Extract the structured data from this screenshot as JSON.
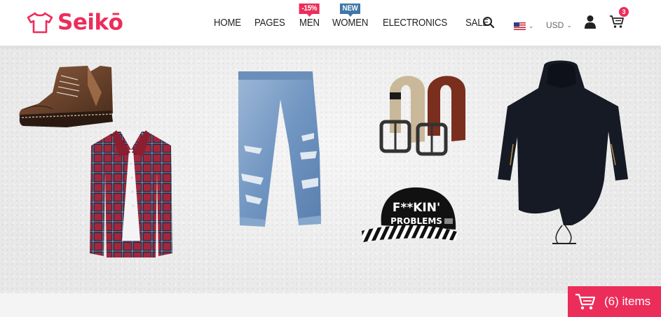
{
  "brand": {
    "name": "Seikō"
  },
  "nav": {
    "items": [
      {
        "label": "HOME",
        "badge": ""
      },
      {
        "label": "PAGES",
        "badge": ""
      },
      {
        "label": "MEN",
        "badge": "-15%"
      },
      {
        "label": "WOMEN",
        "badge": "NEW"
      },
      {
        "label": "ELECTRONICS",
        "badge": ""
      },
      {
        "label": "SALE",
        "badge": ""
      }
    ]
  },
  "header_tools": {
    "search_icon": "search-icon",
    "language_icon": "us-flag-icon",
    "currency": "USD",
    "account_icon": "user-icon",
    "cart_icon": "cart-icon",
    "cart_count": "3"
  },
  "hero": {
    "products": [
      "boot",
      "plaid-shirt",
      "ripped-jeans",
      "belts",
      "snapback-cap",
      "black-parka"
    ],
    "cap_text_line1": "F**KIN'",
    "cap_text_line2": "PROBLEMS"
  },
  "floating_cart": {
    "label": "(6) items"
  },
  "colors": {
    "accent": "#ec2d5a",
    "badge_blue": "#3f77a8"
  }
}
